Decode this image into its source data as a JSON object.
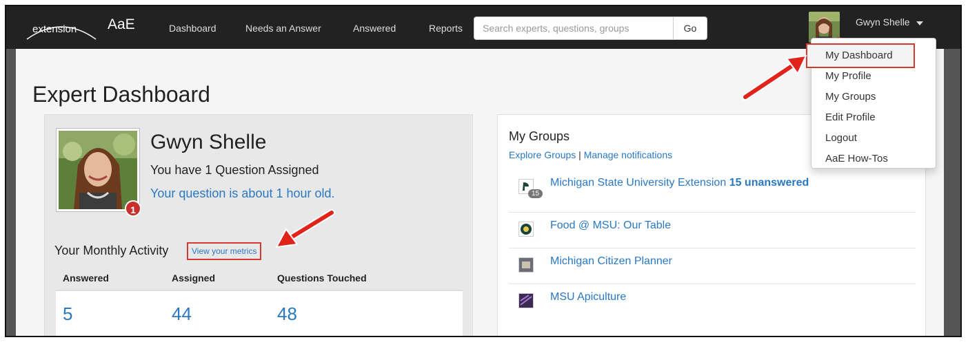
{
  "navbar": {
    "logo_text": "extension",
    "brand": "AaE",
    "links": [
      "Dashboard",
      "Needs an Answer",
      "Answered",
      "Reports"
    ],
    "search_placeholder": "Search experts, questions, groups",
    "search_button": "Go",
    "user_name": "Gwyn Shelle"
  },
  "page": {
    "title": "Expert Dashboard"
  },
  "profile": {
    "name": "Gwyn Shelle",
    "badge": "1",
    "assigned_text": "You have 1 Question Assigned",
    "age_text": "Your question is about 1 hour old."
  },
  "activity": {
    "title": "Your Monthly Activity",
    "metrics_link": "View your metrics",
    "columns": [
      "Answered",
      "Assigned",
      "Questions Touched"
    ],
    "values": [
      "5",
      "44",
      "48"
    ]
  },
  "groups": {
    "title": "My Groups",
    "explore_link": "Explore Groups",
    "separator": "|",
    "manage_link": "Manage notifications",
    "items": [
      {
        "name": "Michigan State University Extension",
        "status": "15 unanswered",
        "count": "15"
      },
      {
        "name": "Food @ MSU: Our Table"
      },
      {
        "name": "Michigan Citizen Planner"
      },
      {
        "name": "MSU Apiculture"
      }
    ]
  },
  "dropdown": {
    "items": [
      "My Dashboard",
      "My Profile",
      "My Groups",
      "Edit Profile",
      "Logout",
      "AaE How-Tos"
    ]
  },
  "colors": {
    "navbar": "#222222",
    "link": "#2a78c2",
    "highlight": "#d23a31",
    "badge": "#c9302c"
  }
}
